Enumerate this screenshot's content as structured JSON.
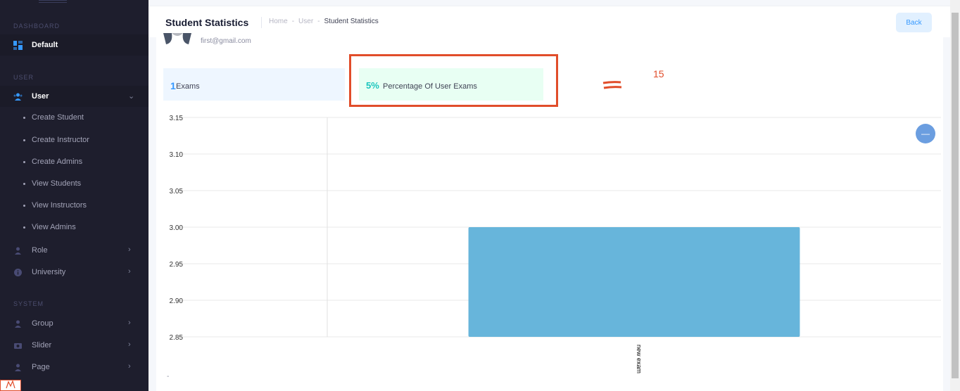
{
  "sidebar": {
    "sections": {
      "dashboard": "DASHBOARD",
      "user": "USER",
      "system": "SYSTEM"
    },
    "default_label": "Default",
    "user_label": "User",
    "sub_items": [
      "Create Student",
      "Create Instructor",
      "Create Admins",
      "View Students",
      "View Instructors",
      "View Admins"
    ],
    "role_label": "Role",
    "university_label": "University",
    "group_label": "Group",
    "slider_label": "Slider",
    "page_label": "Page"
  },
  "header": {
    "title": "Student Statistics",
    "breadcrumb": [
      "Home",
      "-",
      "User",
      "-",
      "Student Statistics"
    ],
    "back_label": "Back"
  },
  "profile": {
    "email": "first@gmail.com"
  },
  "stats": {
    "exams_count": "1",
    "exams_label": "Exams",
    "percentage_value": "5%",
    "percentage_label": "Percentage Of User Exams"
  },
  "annotation": {
    "number": "15",
    "color": "#e14d2a"
  },
  "collapse_icon": "minus-icon",
  "footer_mark": "-",
  "chart_data": {
    "type": "bar",
    "categories": [
      "new exam"
    ],
    "values": [
      3.0
    ],
    "ylim": [
      2.85,
      3.15
    ],
    "yticks": [
      "3.15",
      "3.10",
      "3.05",
      "3.00",
      "2.95",
      "2.90",
      "2.85"
    ],
    "grid": true,
    "bar_color": "#67b5db",
    "title": "",
    "xlabel": "",
    "ylabel": ""
  }
}
